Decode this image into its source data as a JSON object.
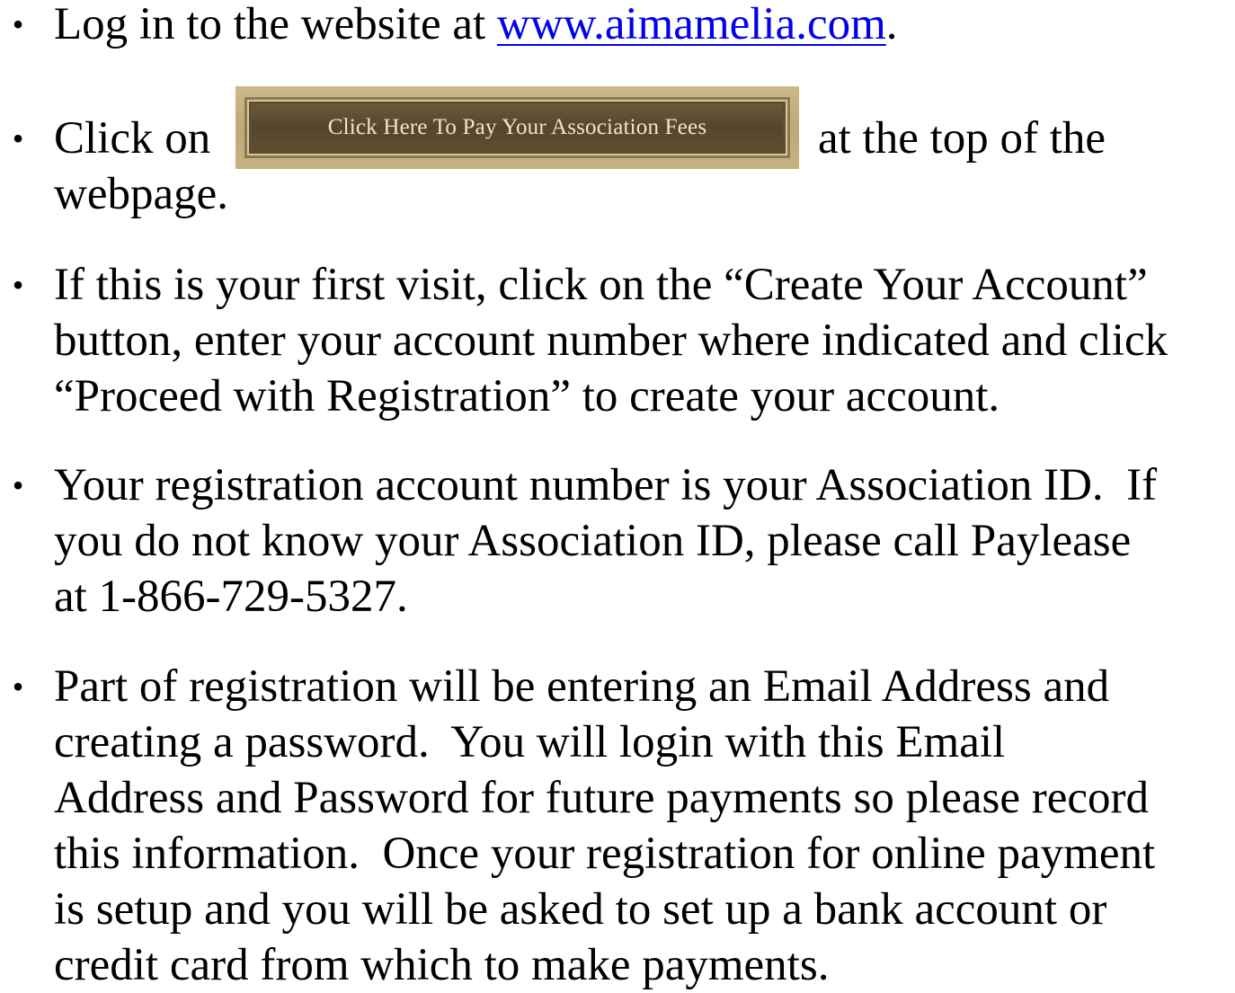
{
  "instructions": [
    {
      "before": "Log in to the website at ",
      "link": "www.aimamelia.com",
      "after": "."
    },
    {
      "before": "Click on",
      "button_label": "Click Here To Pay Your Association Fees",
      "after": "at the top of the",
      "continuation": "webpage."
    },
    {
      "lines": [
        "If this is your first visit, click on the “Create Your Account”",
        "button, enter your account number where indicated and click",
        "“Proceed with Registration” to create your account."
      ]
    },
    {
      "lines": [
        "Your registration account number is your Association ID.  If",
        "you do not know your Association ID, please call Paylease",
        "at 1-866-729-5327."
      ]
    },
    {
      "lines": [
        "Part of registration will be entering an Email Address and",
        "creating a password.  You will login with this Email",
        "Address and Password for future payments so please record",
        "this information.  Once your registration for online payment",
        "is setup and you will be asked to set up a bank account or",
        "credit card from which to make payments."
      ]
    }
  ],
  "bullet_glyph": "•",
  "colors": {
    "link": "#0000ee",
    "text": "#000000",
    "button_frame": "#c4af7f",
    "button_face": "#5e4f33",
    "button_text": "#efe6c8"
  }
}
